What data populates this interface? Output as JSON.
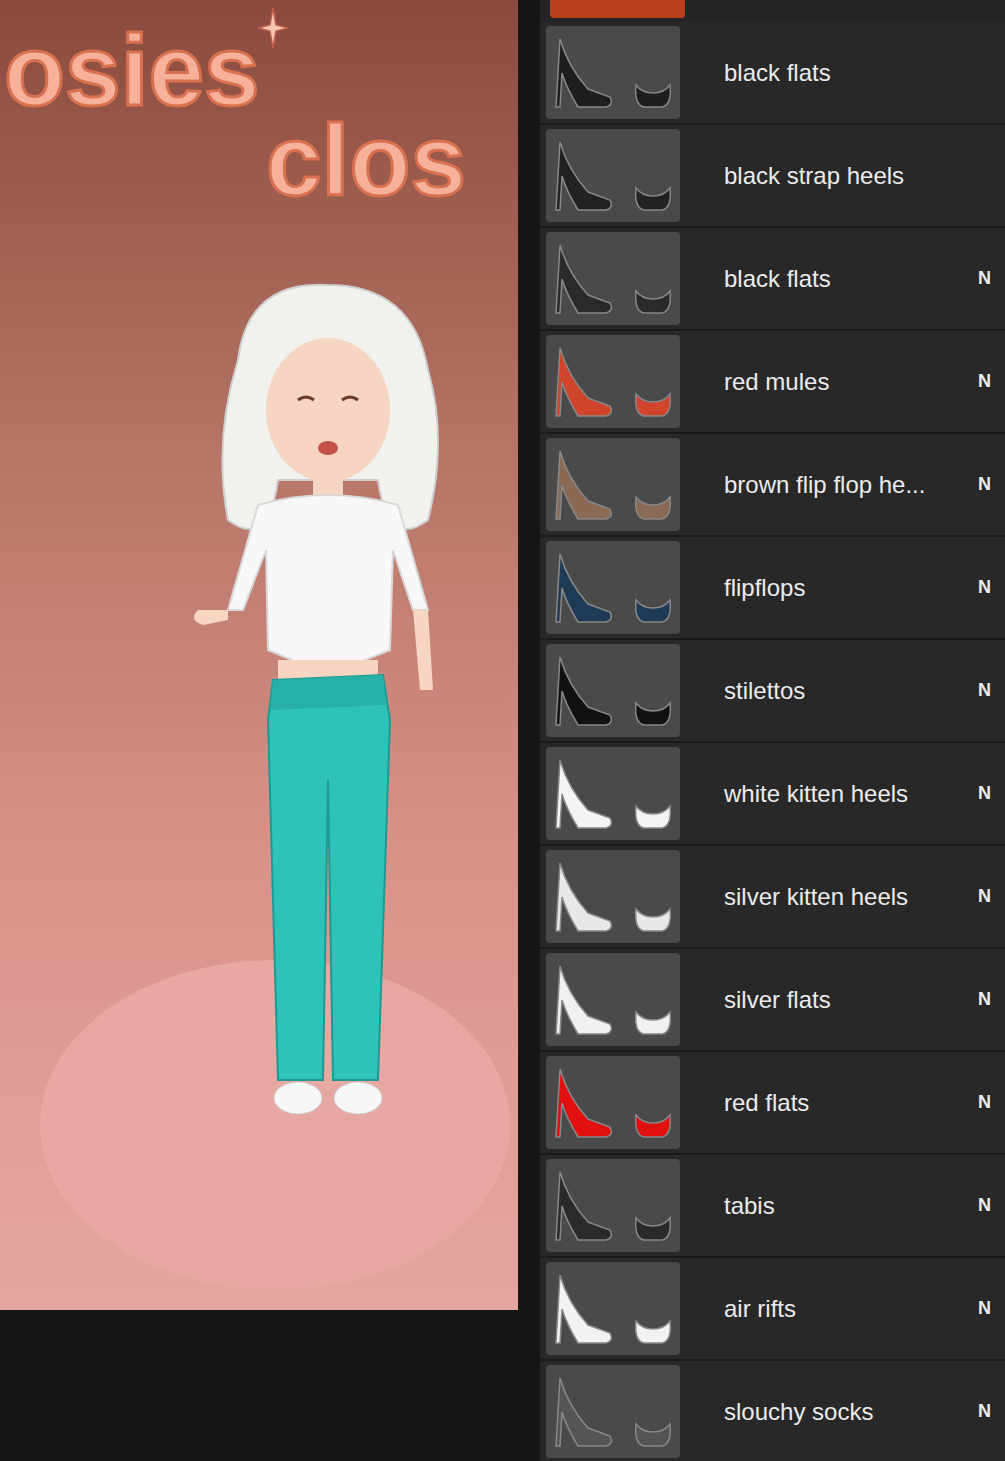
{
  "game": {
    "logo": {
      "line1": "osies",
      "line2": "clos"
    }
  },
  "cut_item": {
    "color": "#b8401c"
  },
  "items": [
    {
      "name": "black flats",
      "color": "#1e1e1e"
    },
    {
      "name": "black strap heels",
      "color": "#222222"
    },
    {
      "name": "black flats",
      "badge": "N",
      "color": "#2a2a2a"
    },
    {
      "name": "red mules",
      "badge": "N",
      "color": "#d0452c"
    },
    {
      "name": "brown flip flop he...",
      "badge": "N",
      "color": "#8a6a55"
    },
    {
      "name": "flipflops",
      "badge": "N",
      "color": "#1f3a55"
    },
    {
      "name": "stilettos",
      "badge": "N",
      "color": "#111111"
    },
    {
      "name": "white kitten heels",
      "badge": "N",
      "color": "#f4f4f4"
    },
    {
      "name": "silver kitten heels",
      "badge": "N",
      "color": "#e8e8e8"
    },
    {
      "name": "silver flats",
      "badge": "N",
      "color": "#f0f0f0"
    },
    {
      "name": "red flats",
      "badge": "N",
      "color": "#e01010"
    },
    {
      "name": "tabis",
      "badge": "N",
      "color": "#2a2a2a"
    },
    {
      "name": "air rifts",
      "badge": "N",
      "color": "#f2f2f2"
    },
    {
      "name": "slouchy socks",
      "badge": "N",
      "color": "#555555"
    }
  ]
}
